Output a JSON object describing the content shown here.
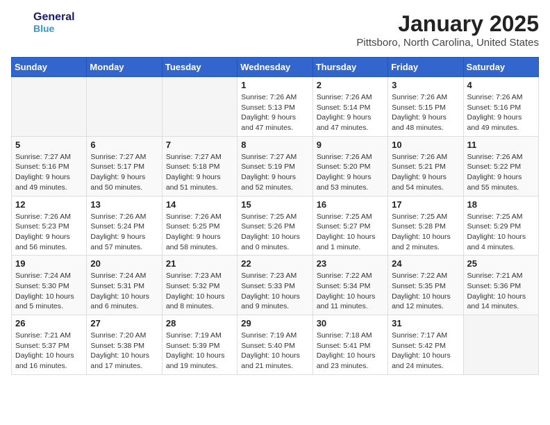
{
  "logo": {
    "name_line1": "General",
    "name_line2": "Blue"
  },
  "header": {
    "month": "January 2025",
    "location": "Pittsboro, North Carolina, United States"
  },
  "weekdays": [
    "Sunday",
    "Monday",
    "Tuesday",
    "Wednesday",
    "Thursday",
    "Friday",
    "Saturday"
  ],
  "weeks": [
    [
      {
        "day": "",
        "info": ""
      },
      {
        "day": "",
        "info": ""
      },
      {
        "day": "",
        "info": ""
      },
      {
        "day": "1",
        "info": "Sunrise: 7:26 AM\nSunset: 5:13 PM\nDaylight: 9 hours\nand 47 minutes."
      },
      {
        "day": "2",
        "info": "Sunrise: 7:26 AM\nSunset: 5:14 PM\nDaylight: 9 hours\nand 47 minutes."
      },
      {
        "day": "3",
        "info": "Sunrise: 7:26 AM\nSunset: 5:15 PM\nDaylight: 9 hours\nand 48 minutes."
      },
      {
        "day": "4",
        "info": "Sunrise: 7:26 AM\nSunset: 5:16 PM\nDaylight: 9 hours\nand 49 minutes."
      }
    ],
    [
      {
        "day": "5",
        "info": "Sunrise: 7:27 AM\nSunset: 5:16 PM\nDaylight: 9 hours\nand 49 minutes."
      },
      {
        "day": "6",
        "info": "Sunrise: 7:27 AM\nSunset: 5:17 PM\nDaylight: 9 hours\nand 50 minutes."
      },
      {
        "day": "7",
        "info": "Sunrise: 7:27 AM\nSunset: 5:18 PM\nDaylight: 9 hours\nand 51 minutes."
      },
      {
        "day": "8",
        "info": "Sunrise: 7:27 AM\nSunset: 5:19 PM\nDaylight: 9 hours\nand 52 minutes."
      },
      {
        "day": "9",
        "info": "Sunrise: 7:26 AM\nSunset: 5:20 PM\nDaylight: 9 hours\nand 53 minutes."
      },
      {
        "day": "10",
        "info": "Sunrise: 7:26 AM\nSunset: 5:21 PM\nDaylight: 9 hours\nand 54 minutes."
      },
      {
        "day": "11",
        "info": "Sunrise: 7:26 AM\nSunset: 5:22 PM\nDaylight: 9 hours\nand 55 minutes."
      }
    ],
    [
      {
        "day": "12",
        "info": "Sunrise: 7:26 AM\nSunset: 5:23 PM\nDaylight: 9 hours\nand 56 minutes."
      },
      {
        "day": "13",
        "info": "Sunrise: 7:26 AM\nSunset: 5:24 PM\nDaylight: 9 hours\nand 57 minutes."
      },
      {
        "day": "14",
        "info": "Sunrise: 7:26 AM\nSunset: 5:25 PM\nDaylight: 9 hours\nand 58 minutes."
      },
      {
        "day": "15",
        "info": "Sunrise: 7:25 AM\nSunset: 5:26 PM\nDaylight: 10 hours\nand 0 minutes."
      },
      {
        "day": "16",
        "info": "Sunrise: 7:25 AM\nSunset: 5:27 PM\nDaylight: 10 hours\nand 1 minute."
      },
      {
        "day": "17",
        "info": "Sunrise: 7:25 AM\nSunset: 5:28 PM\nDaylight: 10 hours\nand 2 minutes."
      },
      {
        "day": "18",
        "info": "Sunrise: 7:25 AM\nSunset: 5:29 PM\nDaylight: 10 hours\nand 4 minutes."
      }
    ],
    [
      {
        "day": "19",
        "info": "Sunrise: 7:24 AM\nSunset: 5:30 PM\nDaylight: 10 hours\nand 5 minutes."
      },
      {
        "day": "20",
        "info": "Sunrise: 7:24 AM\nSunset: 5:31 PM\nDaylight: 10 hours\nand 6 minutes."
      },
      {
        "day": "21",
        "info": "Sunrise: 7:23 AM\nSunset: 5:32 PM\nDaylight: 10 hours\nand 8 minutes."
      },
      {
        "day": "22",
        "info": "Sunrise: 7:23 AM\nSunset: 5:33 PM\nDaylight: 10 hours\nand 9 minutes."
      },
      {
        "day": "23",
        "info": "Sunrise: 7:22 AM\nSunset: 5:34 PM\nDaylight: 10 hours\nand 11 minutes."
      },
      {
        "day": "24",
        "info": "Sunrise: 7:22 AM\nSunset: 5:35 PM\nDaylight: 10 hours\nand 12 minutes."
      },
      {
        "day": "25",
        "info": "Sunrise: 7:21 AM\nSunset: 5:36 PM\nDaylight: 10 hours\nand 14 minutes."
      }
    ],
    [
      {
        "day": "26",
        "info": "Sunrise: 7:21 AM\nSunset: 5:37 PM\nDaylight: 10 hours\nand 16 minutes."
      },
      {
        "day": "27",
        "info": "Sunrise: 7:20 AM\nSunset: 5:38 PM\nDaylight: 10 hours\nand 17 minutes."
      },
      {
        "day": "28",
        "info": "Sunrise: 7:19 AM\nSunset: 5:39 PM\nDaylight: 10 hours\nand 19 minutes."
      },
      {
        "day": "29",
        "info": "Sunrise: 7:19 AM\nSunset: 5:40 PM\nDaylight: 10 hours\nand 21 minutes."
      },
      {
        "day": "30",
        "info": "Sunrise: 7:18 AM\nSunset: 5:41 PM\nDaylight: 10 hours\nand 23 minutes."
      },
      {
        "day": "31",
        "info": "Sunrise: 7:17 AM\nSunset: 5:42 PM\nDaylight: 10 hours\nand 24 minutes."
      },
      {
        "day": "",
        "info": ""
      }
    ]
  ]
}
